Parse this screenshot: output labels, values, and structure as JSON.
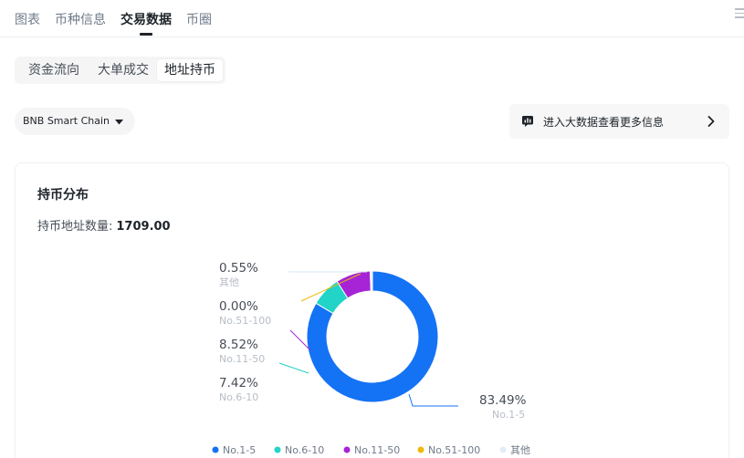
{
  "topnav": {
    "tabs": [
      {
        "label": "图表"
      },
      {
        "label": "币种信息"
      },
      {
        "label": "交易数据",
        "active": true
      },
      {
        "label": "币圈"
      }
    ]
  },
  "subtabs": {
    "items": [
      {
        "label": "资金流向"
      },
      {
        "label": "大单成交"
      },
      {
        "label": "地址持币",
        "active": true
      }
    ]
  },
  "chain_select": {
    "value": "BNB Smart Chain"
  },
  "bigdata_link": {
    "label": "进入大数据查看更多信息"
  },
  "holdings": {
    "title": "持币分布",
    "count_label": "持币地址数量:",
    "count_value": "1709.00"
  },
  "colors": {
    "no1_5": "#1472f4",
    "no6_10": "#22d3c8",
    "no11_50": "#a624d6",
    "no51_100": "#f0b90b",
    "other": "#e3ecf7"
  },
  "chart_data": {
    "type": "pie",
    "donut": true,
    "slices": [
      {
        "name": "No.1-5",
        "value": 83.49,
        "label": "83.49%"
      },
      {
        "name": "No.6-10",
        "value": 7.42,
        "label": "7.42%"
      },
      {
        "name": "No.11-50",
        "value": 8.52,
        "label": "8.52%"
      },
      {
        "name": "No.51-100",
        "value": 0.0,
        "label": "0.00%"
      },
      {
        "name": "其他",
        "value": 0.55,
        "label": "0.55%"
      }
    ],
    "legend": [
      "No.1-5",
      "No.6-10",
      "No.11-50",
      "No.51-100",
      "其他"
    ],
    "legend_position": "bottom"
  }
}
